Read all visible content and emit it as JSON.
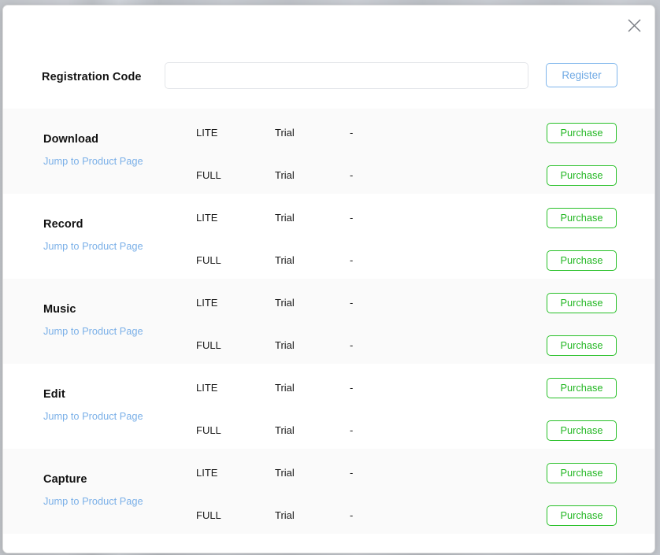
{
  "dialog": {
    "close_icon": "close-icon"
  },
  "header": {
    "registration_label": "Registration Code",
    "registration_value": "",
    "registration_placeholder": "",
    "register_label": "Register"
  },
  "colors": {
    "purchase_green": "#28c028",
    "register_blue": "#7fb6ec",
    "link_blue": "#7bb0e8",
    "row_alt_bg": "#fafafa",
    "row_bg": "#ffffff"
  },
  "list": {
    "link_label": "Jump to Product Page",
    "purchase_label": "Purchase",
    "products": [
      {
        "name": "Download",
        "link": "Jump to Product Page",
        "editions": [
          {
            "edition": "LITE",
            "status": "Trial",
            "expire": "-",
            "action": "Purchase"
          },
          {
            "edition": "FULL",
            "status": "Trial",
            "expire": "-",
            "action": "Purchase"
          }
        ]
      },
      {
        "name": "Record",
        "link": "Jump to Product Page",
        "editions": [
          {
            "edition": "LITE",
            "status": "Trial",
            "expire": "-",
            "action": "Purchase"
          },
          {
            "edition": "FULL",
            "status": "Trial",
            "expire": "-",
            "action": "Purchase"
          }
        ]
      },
      {
        "name": "Music",
        "link": "Jump to Product Page",
        "editions": [
          {
            "edition": "LITE",
            "status": "Trial",
            "expire": "-",
            "action": "Purchase"
          },
          {
            "edition": "FULL",
            "status": "Trial",
            "expire": "-",
            "action": "Purchase"
          }
        ]
      },
      {
        "name": "Edit",
        "link": "Jump to Product Page",
        "editions": [
          {
            "edition": "LITE",
            "status": "Trial",
            "expire": "-",
            "action": "Purchase"
          },
          {
            "edition": "FULL",
            "status": "Trial",
            "expire": "-",
            "action": "Purchase"
          }
        ]
      },
      {
        "name": "Capture",
        "link": "Jump to Product Page",
        "editions": [
          {
            "edition": "LITE",
            "status": "Trial",
            "expire": "-",
            "action": "Purchase"
          },
          {
            "edition": "FULL",
            "status": "Trial",
            "expire": "-",
            "action": "Purchase"
          }
        ]
      }
    ]
  }
}
